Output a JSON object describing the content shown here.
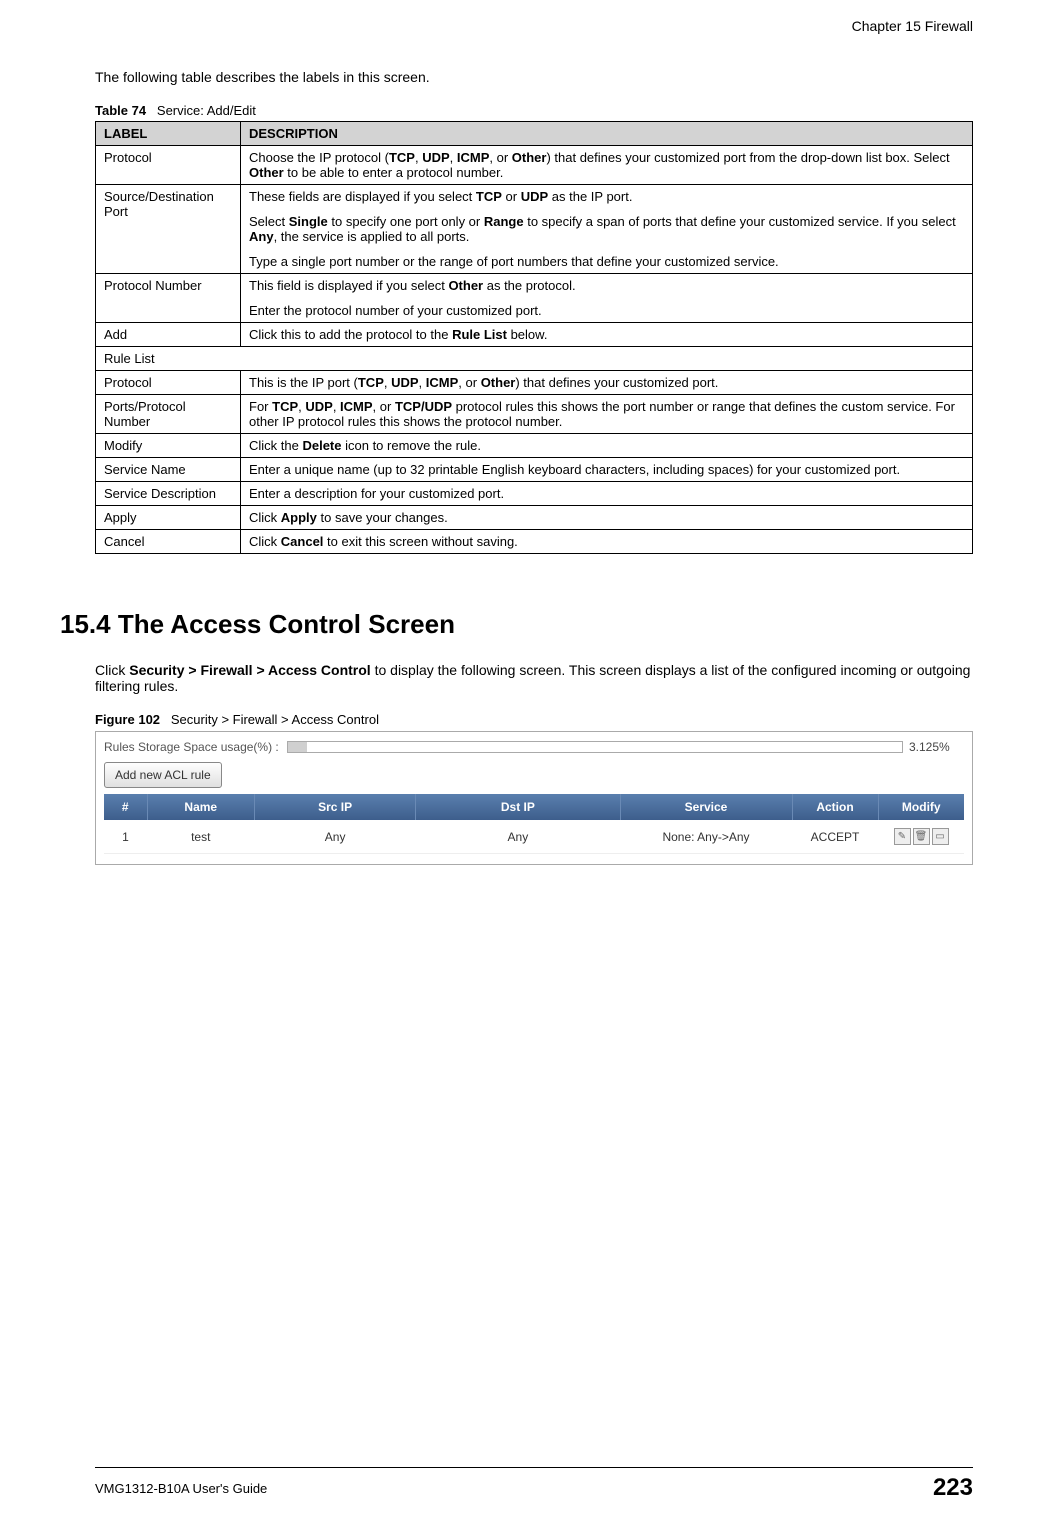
{
  "header": {
    "chapter": "Chapter 15 Firewall"
  },
  "intro": "The following table describes the labels in this screen.",
  "table74": {
    "caption_bold": "Table 74",
    "caption_text": "Service: Add/Edit",
    "headers": {
      "label": "LABEL",
      "description": "DESCRIPTION"
    },
    "rows": {
      "protocol": {
        "label": "Protocol",
        "desc_pre": "Choose the IP protocol (",
        "b1": "TCP",
        "s1": ", ",
        "b2": "UDP",
        "s2": ", ",
        "b3": "ICMP",
        "s3": ", or ",
        "b4": "Other",
        "desc_mid": ") that defines your customized port from the drop-down list box. Select ",
        "b5": "Other",
        "desc_post": " to be able to enter a protocol number."
      },
      "srcport": {
        "label": "Source/Destination Port",
        "p1_pre": "These fields are displayed if you select ",
        "p1_b1": "TCP",
        "p1_s1": " or ",
        "p1_b2": "UDP",
        "p1_post": " as the IP port.",
        "p2_pre": "Select ",
        "p2_b1": "Single",
        "p2_s1": " to specify one port only or ",
        "p2_b2": "Range",
        "p2_s2": " to specify a span of ports that define your customized service. If you select ",
        "p2_b3": "Any",
        "p2_post": ", the service is applied to all ports.",
        "p3": "Type a single port number or the range of port numbers that define your customized service."
      },
      "protonum": {
        "label": "Protocol Number",
        "p1_pre": "This field is displayed if you select ",
        "p1_b1": "Other",
        "p1_post": " as the protocol.",
        "p2": "Enter the protocol number of your customized port."
      },
      "add": {
        "label": "Add",
        "desc_pre": "Click this to add the protocol to the ",
        "b1": "Rule List",
        "desc_post": " below."
      },
      "rulelist": {
        "label": "Rule List"
      },
      "protocol2": {
        "label": "Protocol",
        "desc_pre": "This is the IP port (",
        "b1": "TCP",
        "s1": ", ",
        "b2": "UDP",
        "s2": ", ",
        "b3": "ICMP",
        "s3": ", or ",
        "b4": "Other",
        "desc_post": ") that defines your customized port."
      },
      "ports": {
        "label": "Ports/Protocol Number",
        "desc_pre": "For ",
        "b1": "TCP",
        "s1": ", ",
        "b2": "UDP",
        "s2": ", ",
        "b3": "ICMP",
        "s3": ", or ",
        "b4": "TCP/UDP",
        "desc_post": " protocol rules this shows the port number or range that defines the custom service. For other IP protocol rules this shows the protocol number."
      },
      "modify": {
        "label": "Modify",
        "desc_pre": "Click the ",
        "b1": "Delete",
        "desc_post": " icon to remove the rule."
      },
      "svcname": {
        "label": "Service Name",
        "desc": "Enter a unique name (up to 32 printable English keyboard characters, including spaces) for your customized port."
      },
      "svcdesc": {
        "label": "Service Description",
        "desc": "Enter a description for your customized port."
      },
      "apply": {
        "label": "Apply",
        "desc_pre": "Click ",
        "b1": "Apply",
        "desc_post": " to save your changes."
      },
      "cancel": {
        "label": "Cancel",
        "desc_pre": "Click ",
        "b1": "Cancel",
        "desc_post": " to exit this screen without saving."
      }
    }
  },
  "section": {
    "heading": "15.4  The Access Control Screen",
    "text_pre": "Click ",
    "b1": "Security > Firewall > Access Control",
    "text_post": " to display the following screen. This screen displays a list of the configured incoming or outgoing filtering rules."
  },
  "figure": {
    "caption_bold": "Figure 102",
    "caption_text": "Security > Firewall > Access Control"
  },
  "screenshot": {
    "storage_label": "Rules Storage Space usage(%) :",
    "storage_percent": "3.125%",
    "add_button": "Add new ACL rule",
    "headers": {
      "num": "#",
      "name": "Name",
      "srcip": "Src IP",
      "dstip": "Dst IP",
      "service": "Service",
      "action": "Action",
      "modify": "Modify"
    },
    "row": {
      "num": "1",
      "name": "test",
      "srcip": "Any",
      "dstip": "Any",
      "service": "None: Any->Any",
      "action": "ACCEPT"
    }
  },
  "footer": {
    "guide": "VMG1312-B10A User's Guide",
    "page": "223"
  }
}
